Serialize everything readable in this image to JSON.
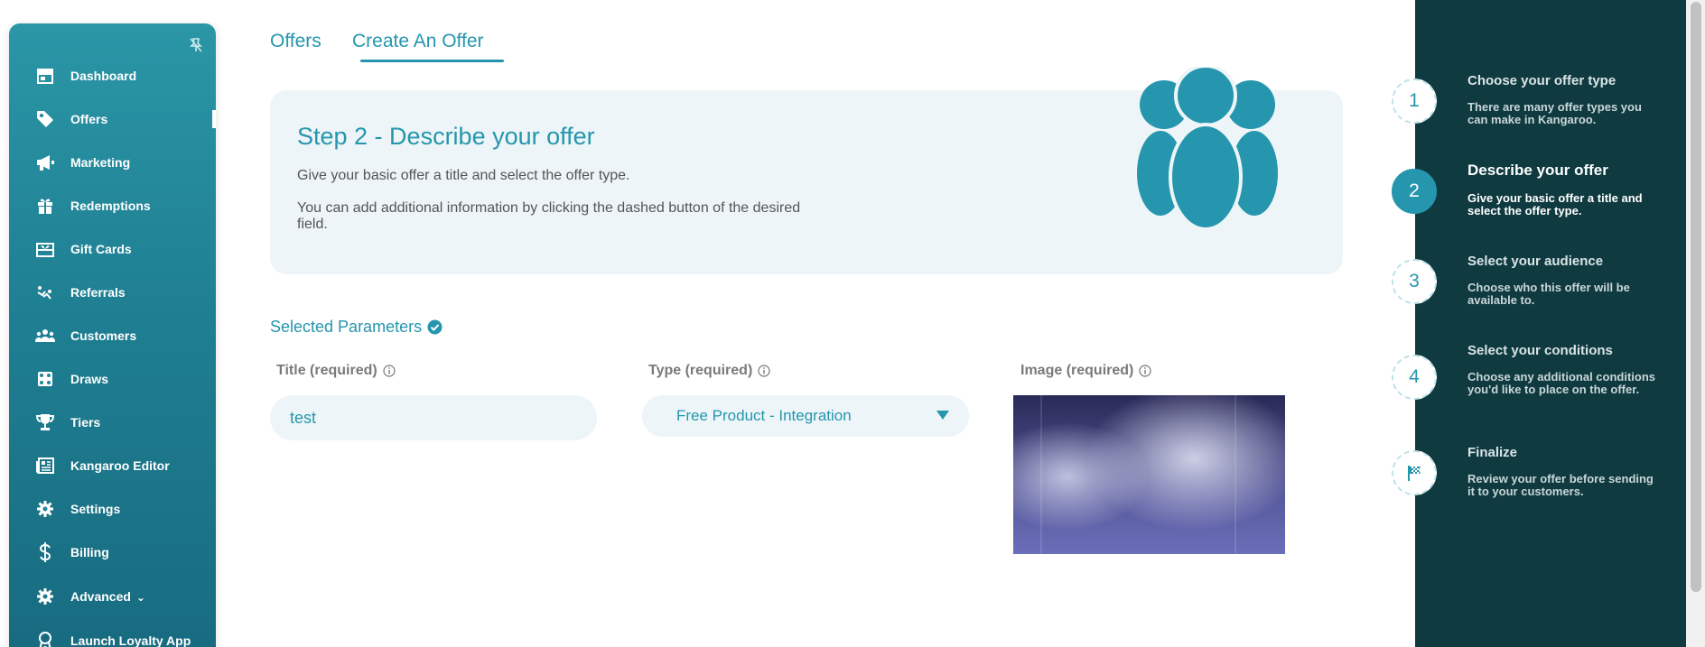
{
  "sidebar": {
    "items": [
      {
        "label": "Dashboard",
        "icon": "store-icon"
      },
      {
        "label": "Offers",
        "icon": "tag-icon",
        "active": true
      },
      {
        "label": "Marketing",
        "icon": "megaphone-icon"
      },
      {
        "label": "Redemptions",
        "icon": "gift-icon"
      },
      {
        "label": "Gift Cards",
        "icon": "gift-card-icon"
      },
      {
        "label": "Referrals",
        "icon": "referral-icon"
      },
      {
        "label": "Customers",
        "icon": "users-icon"
      },
      {
        "label": "Draws",
        "icon": "dice-icon"
      },
      {
        "label": "Tiers",
        "icon": "trophy-icon"
      },
      {
        "label": "Kangaroo Editor",
        "icon": "newspaper-icon"
      },
      {
        "label": "Settings",
        "icon": "gear-icon"
      },
      {
        "label": "Billing",
        "icon": "dollar-icon"
      },
      {
        "label": "Advanced",
        "icon": "gear-icon"
      },
      {
        "label": "Launch Loyalty App",
        "icon": "ribbon-icon"
      }
    ]
  },
  "tabs": [
    {
      "label": "Offers"
    },
    {
      "label": "Create An Offer",
      "active": true
    }
  ],
  "info_card": {
    "title": "Step 2 - Describe your offer",
    "paragraph1": "Give your basic offer a title and select the offer type.",
    "paragraph2": "You can add additional information by clicking the dashed button of the desired field."
  },
  "parameters": {
    "section_title": "Selected Parameters",
    "title_label": "Title (required)",
    "title_value": "test",
    "type_label": "Type (required)",
    "type_value": "Free Product - Integration",
    "image_label": "Image (required)"
  },
  "steps": [
    {
      "number": "1",
      "title": "Choose your offer type",
      "desc": "There are many offer types you can make in Kangaroo."
    },
    {
      "number": "2",
      "title": "Describe your offer",
      "desc": "Give your basic offer a title and select the offer type.",
      "active": true
    },
    {
      "number": "3",
      "title": "Select your audience",
      "desc": "Choose who this offer will be available to."
    },
    {
      "number": "4",
      "title": "Select your conditions",
      "desc": "Choose any additional conditions you'd like to place on the offer."
    },
    {
      "number": "",
      "icon": "flag-icon",
      "title": "Finalize",
      "desc": "Review your offer before sending it to your customers."
    }
  ],
  "colors": {
    "accent": "#2596ad",
    "sidebar": "#1f7f92",
    "panel": "#0f3a40",
    "card": "#edf5f8"
  }
}
